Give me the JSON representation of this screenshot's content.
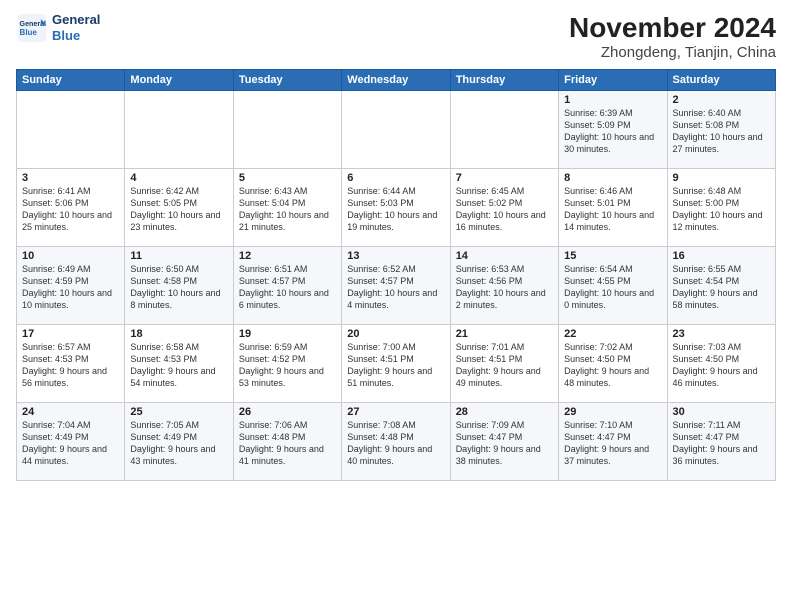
{
  "header": {
    "logo_line1": "General",
    "logo_line2": "Blue",
    "month": "November 2024",
    "location": "Zhongdeng, Tianjin, China"
  },
  "weekdays": [
    "Sunday",
    "Monday",
    "Tuesday",
    "Wednesday",
    "Thursday",
    "Friday",
    "Saturday"
  ],
  "weeks": [
    [
      {
        "day": "",
        "info": ""
      },
      {
        "day": "",
        "info": ""
      },
      {
        "day": "",
        "info": ""
      },
      {
        "day": "",
        "info": ""
      },
      {
        "day": "",
        "info": ""
      },
      {
        "day": "1",
        "info": "Sunrise: 6:39 AM\nSunset: 5:09 PM\nDaylight: 10 hours and 30 minutes."
      },
      {
        "day": "2",
        "info": "Sunrise: 6:40 AM\nSunset: 5:08 PM\nDaylight: 10 hours and 27 minutes."
      }
    ],
    [
      {
        "day": "3",
        "info": "Sunrise: 6:41 AM\nSunset: 5:06 PM\nDaylight: 10 hours and 25 minutes."
      },
      {
        "day": "4",
        "info": "Sunrise: 6:42 AM\nSunset: 5:05 PM\nDaylight: 10 hours and 23 minutes."
      },
      {
        "day": "5",
        "info": "Sunrise: 6:43 AM\nSunset: 5:04 PM\nDaylight: 10 hours and 21 minutes."
      },
      {
        "day": "6",
        "info": "Sunrise: 6:44 AM\nSunset: 5:03 PM\nDaylight: 10 hours and 19 minutes."
      },
      {
        "day": "7",
        "info": "Sunrise: 6:45 AM\nSunset: 5:02 PM\nDaylight: 10 hours and 16 minutes."
      },
      {
        "day": "8",
        "info": "Sunrise: 6:46 AM\nSunset: 5:01 PM\nDaylight: 10 hours and 14 minutes."
      },
      {
        "day": "9",
        "info": "Sunrise: 6:48 AM\nSunset: 5:00 PM\nDaylight: 10 hours and 12 minutes."
      }
    ],
    [
      {
        "day": "10",
        "info": "Sunrise: 6:49 AM\nSunset: 4:59 PM\nDaylight: 10 hours and 10 minutes."
      },
      {
        "day": "11",
        "info": "Sunrise: 6:50 AM\nSunset: 4:58 PM\nDaylight: 10 hours and 8 minutes."
      },
      {
        "day": "12",
        "info": "Sunrise: 6:51 AM\nSunset: 4:57 PM\nDaylight: 10 hours and 6 minutes."
      },
      {
        "day": "13",
        "info": "Sunrise: 6:52 AM\nSunset: 4:57 PM\nDaylight: 10 hours and 4 minutes."
      },
      {
        "day": "14",
        "info": "Sunrise: 6:53 AM\nSunset: 4:56 PM\nDaylight: 10 hours and 2 minutes."
      },
      {
        "day": "15",
        "info": "Sunrise: 6:54 AM\nSunset: 4:55 PM\nDaylight: 10 hours and 0 minutes."
      },
      {
        "day": "16",
        "info": "Sunrise: 6:55 AM\nSunset: 4:54 PM\nDaylight: 9 hours and 58 minutes."
      }
    ],
    [
      {
        "day": "17",
        "info": "Sunrise: 6:57 AM\nSunset: 4:53 PM\nDaylight: 9 hours and 56 minutes."
      },
      {
        "day": "18",
        "info": "Sunrise: 6:58 AM\nSunset: 4:53 PM\nDaylight: 9 hours and 54 minutes."
      },
      {
        "day": "19",
        "info": "Sunrise: 6:59 AM\nSunset: 4:52 PM\nDaylight: 9 hours and 53 minutes."
      },
      {
        "day": "20",
        "info": "Sunrise: 7:00 AM\nSunset: 4:51 PM\nDaylight: 9 hours and 51 minutes."
      },
      {
        "day": "21",
        "info": "Sunrise: 7:01 AM\nSunset: 4:51 PM\nDaylight: 9 hours and 49 minutes."
      },
      {
        "day": "22",
        "info": "Sunrise: 7:02 AM\nSunset: 4:50 PM\nDaylight: 9 hours and 48 minutes."
      },
      {
        "day": "23",
        "info": "Sunrise: 7:03 AM\nSunset: 4:50 PM\nDaylight: 9 hours and 46 minutes."
      }
    ],
    [
      {
        "day": "24",
        "info": "Sunrise: 7:04 AM\nSunset: 4:49 PM\nDaylight: 9 hours and 44 minutes."
      },
      {
        "day": "25",
        "info": "Sunrise: 7:05 AM\nSunset: 4:49 PM\nDaylight: 9 hours and 43 minutes."
      },
      {
        "day": "26",
        "info": "Sunrise: 7:06 AM\nSunset: 4:48 PM\nDaylight: 9 hours and 41 minutes."
      },
      {
        "day": "27",
        "info": "Sunrise: 7:08 AM\nSunset: 4:48 PM\nDaylight: 9 hours and 40 minutes."
      },
      {
        "day": "28",
        "info": "Sunrise: 7:09 AM\nSunset: 4:47 PM\nDaylight: 9 hours and 38 minutes."
      },
      {
        "day": "29",
        "info": "Sunrise: 7:10 AM\nSunset: 4:47 PM\nDaylight: 9 hours and 37 minutes."
      },
      {
        "day": "30",
        "info": "Sunrise: 7:11 AM\nSunset: 4:47 PM\nDaylight: 9 hours and 36 minutes."
      }
    ]
  ]
}
